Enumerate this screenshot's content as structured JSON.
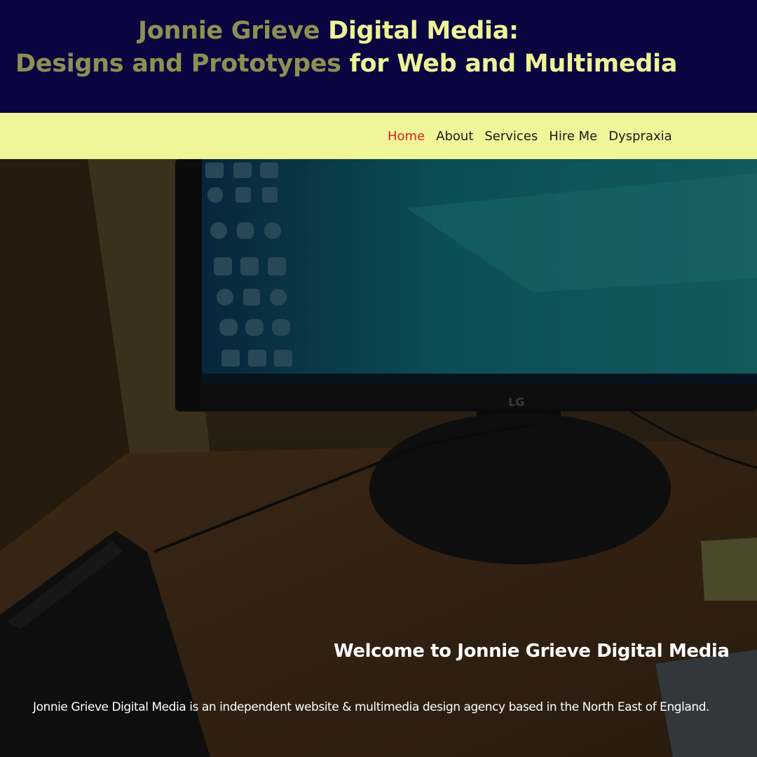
{
  "header": {
    "line1_muted": "Jonnie Grieve",
    "line1_bright": "Digital Media:",
    "line2_muted": "Designs and Prototypes",
    "line2_bright": "for Web and Multimedia"
  },
  "nav": {
    "items": [
      {
        "label": "Home",
        "active": true
      },
      {
        "label": "About"
      },
      {
        "label": "Services"
      },
      {
        "label": "Hire Me"
      },
      {
        "label": "Dyspraxia"
      }
    ]
  },
  "hero": {
    "welcome_heading": "Welcome to Jonnie Grieve Digital Media",
    "intro_text": "Jonnie Grieve Digital Media is an independent website & multimedia design agency based in the North East of England.",
    "monitor_brand": "LG"
  },
  "colors": {
    "header_bg": "#0a0540",
    "title_muted": "#8d9051",
    "title_bright": "#eff396",
    "nav_bg": "#eff598",
    "nav_active": "#e81c1c",
    "nav_text": "#1a1a1a"
  }
}
